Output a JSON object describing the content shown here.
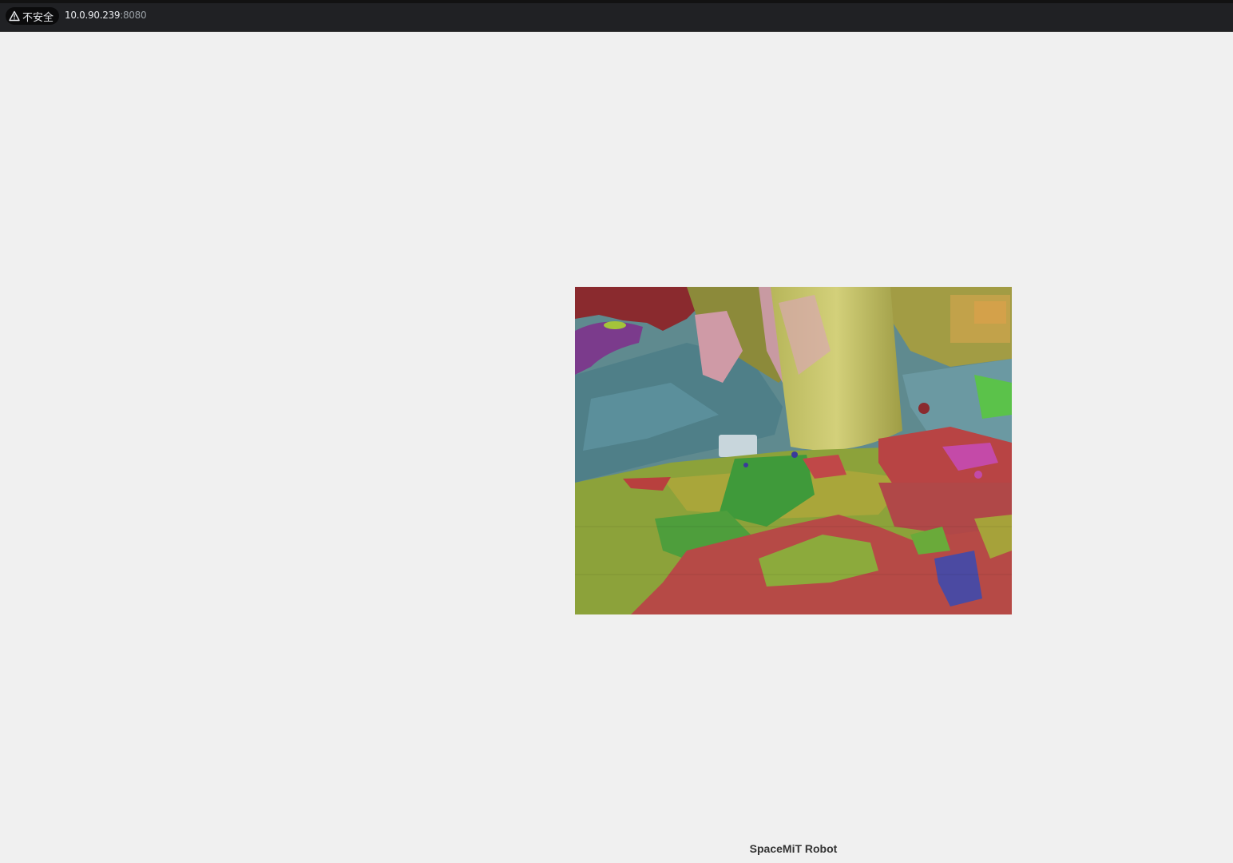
{
  "browser": {
    "security_label": "不安全",
    "url_host": "10.0.90.239",
    "url_port": ":8080",
    "icons": [
      "warning-triangle-icon"
    ]
  },
  "stream": {
    "alt": "segmentation camera stream"
  },
  "footer": {
    "text": "SpaceMiT Robot"
  }
}
